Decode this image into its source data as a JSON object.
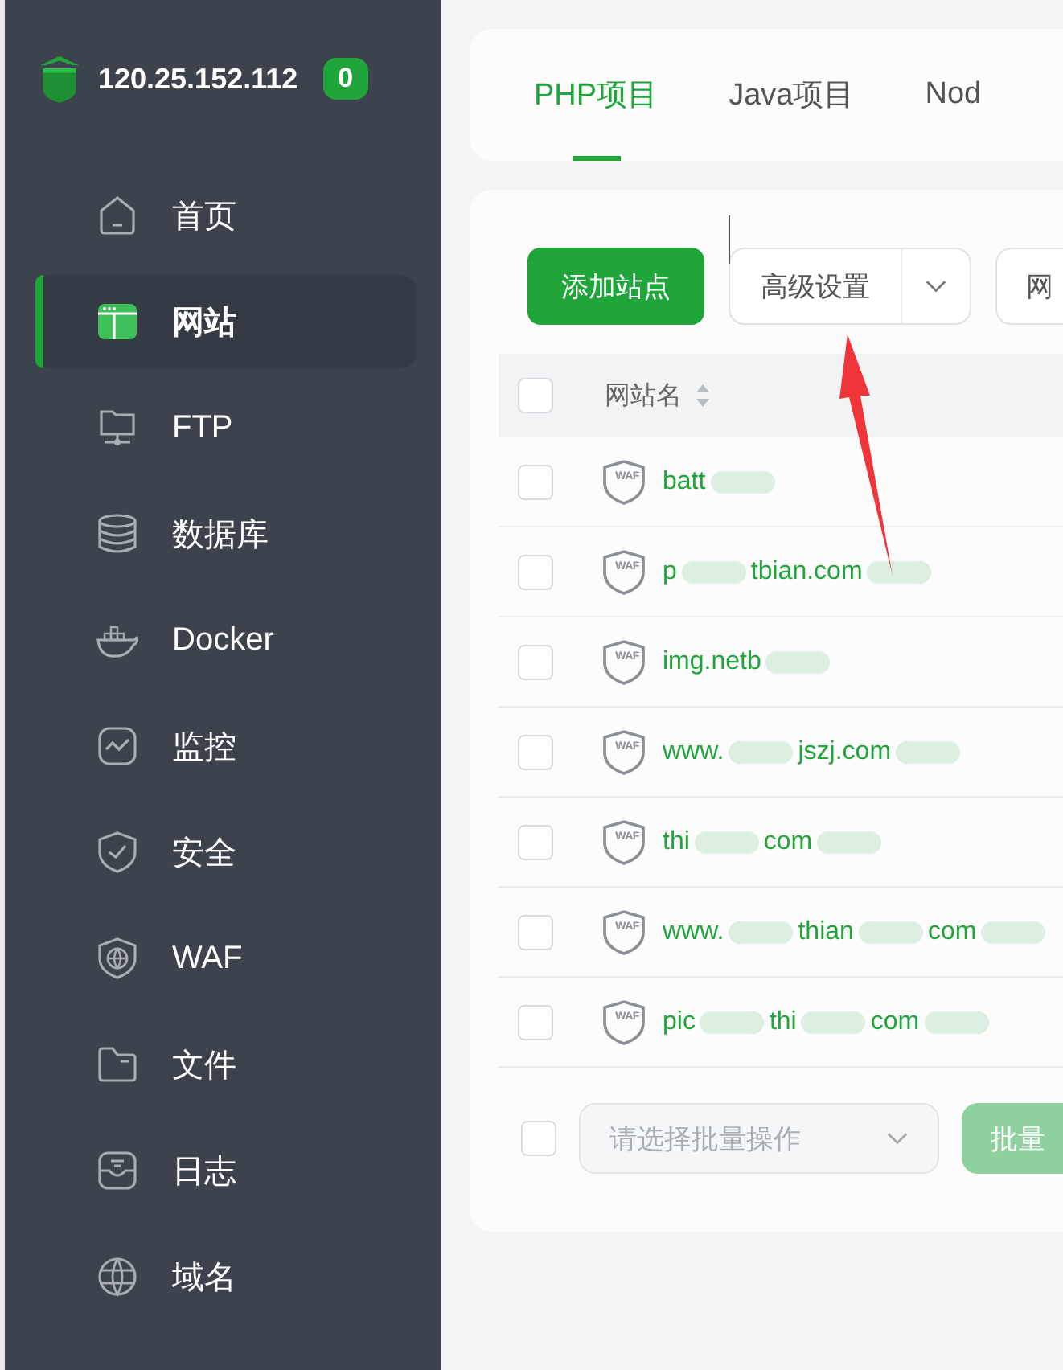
{
  "server": {
    "address": "120.25.152.112",
    "badge": "0"
  },
  "sidebar": {
    "items": [
      {
        "label": "首页",
        "selected": false
      },
      {
        "label": "网站",
        "selected": true
      },
      {
        "label": "FTP",
        "selected": false
      },
      {
        "label": "数据库",
        "selected": false
      },
      {
        "label": "Docker",
        "selected": false
      },
      {
        "label": "监控",
        "selected": false
      },
      {
        "label": "安全",
        "selected": false
      },
      {
        "label": "WAF",
        "selected": false
      },
      {
        "label": "文件",
        "selected": false
      },
      {
        "label": "日志",
        "selected": false
      },
      {
        "label": "域名",
        "selected": false
      }
    ]
  },
  "tabs": [
    {
      "label": "PHP项目",
      "selected": true
    },
    {
      "label": "Java项目",
      "selected": false
    },
    {
      "label": "Nod",
      "selected": false
    }
  ],
  "toolbar": {
    "add_button": "添加站点",
    "advanced_button": "高级设置",
    "next_button": "网"
  },
  "table": {
    "header": "网站名",
    "header_checked": false,
    "rows": [
      {
        "checked": false,
        "badge": "WAF",
        "name_parts": [
          "batt"
        ]
      },
      {
        "checked": false,
        "badge": "WAF",
        "name_parts": [
          "p",
          "tbian.com"
        ]
      },
      {
        "checked": false,
        "badge": "WAF",
        "name_parts": [
          "img.netb"
        ]
      },
      {
        "checked": false,
        "badge": "WAF",
        "name_parts": [
          "www.",
          "jszj.com"
        ]
      },
      {
        "checked": false,
        "badge": "WAF",
        "name_parts": [
          "thi",
          "com"
        ]
      },
      {
        "checked": false,
        "badge": "WAF",
        "name_parts": [
          "www.",
          "thian",
          "com"
        ]
      },
      {
        "checked": false,
        "badge": "WAF",
        "name_parts": [
          "pic",
          "thi",
          "com"
        ]
      }
    ]
  },
  "footer": {
    "checked": false,
    "batch_placeholder": "请选择批量操作",
    "batch_button": "批量"
  }
}
